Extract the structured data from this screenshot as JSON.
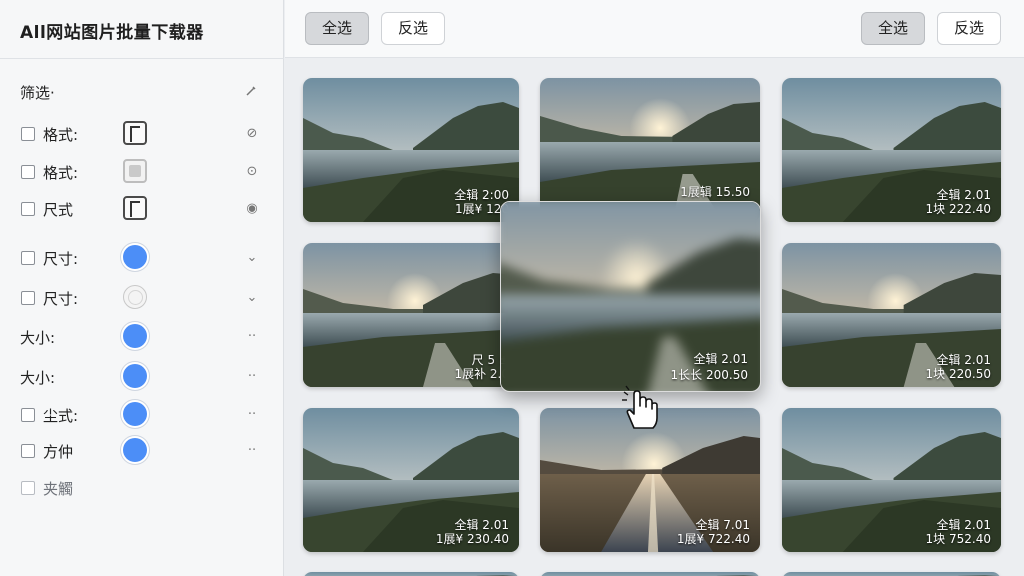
{
  "app": {
    "title": "All网站图片批量下载器"
  },
  "sidebar": {
    "filter_heading": "筛选·",
    "edit_icon": "pencil-icon",
    "rows": [
      {
        "label": "格式:",
        "checkbox": true,
        "control": "frame",
        "icon": "compass-icon",
        "icon_glyph": "⊘"
      },
      {
        "label": "格式:",
        "checkbox": true,
        "control": "gray-square",
        "icon": "play-circle-icon",
        "icon_glyph": "⊙"
      },
      {
        "label": "尺式",
        "checkbox": true,
        "control": "frame",
        "icon": "record-icon",
        "icon_glyph": "◉"
      },
      {
        "label": "尺寸:",
        "checkbox": true,
        "control": "radio-selected",
        "icon": "chevron-down-icon",
        "icon_glyph": "⌄"
      },
      {
        "label": "尺寸:",
        "checkbox": true,
        "control": "radio-empty",
        "icon": "chevron-down-icon",
        "icon_glyph": "⌄"
      },
      {
        "label": "大小:",
        "checkbox": false,
        "control": "radio-selected",
        "icon": "more-dots-icon",
        "icon_glyph": "··"
      },
      {
        "label": "大小:",
        "checkbox": false,
        "control": "radio-selected",
        "icon": "more-dots-icon",
        "icon_glyph": "··"
      },
      {
        "label": "尘式:",
        "checkbox": true,
        "control": "radio-selected",
        "icon": "more-dots-icon",
        "icon_glyph": "··"
      },
      {
        "label": "方仲",
        "checkbox": true,
        "control": "radio-selected",
        "icon": "more-dots-icon",
        "icon_glyph": "··"
      },
      {
        "label": "夹觸",
        "checkbox": true,
        "control": "none",
        "dim": true
      }
    ]
  },
  "toolbar": {
    "left": {
      "select_all": "全选",
      "invert": "反选"
    },
    "right": {
      "select_all": "全选",
      "invert": "反选"
    }
  },
  "grid": {
    "tiles": [
      {
        "line1": "全辑 2:00",
        "line2": "1展¥ 120",
        "scene": "lake"
      },
      {
        "line1": "1展辑 15.50",
        "line2": "",
        "scene": "sunrise"
      },
      {
        "line1": "全辑 2.01",
        "line2": "1块 222.40",
        "scene": "lake"
      },
      {
        "line1": "",
        "line2": "",
        "scene": "sunset"
      },
      {
        "line1": "尺 5 ±",
        "line2": "1展补 2.0",
        "scene": "sunset"
      },
      {
        "line1": "全辑 2.01",
        "line2": "1块 220.50",
        "scene": "sunset"
      },
      {
        "line1": "全辑 2.01",
        "line2": "1展¥ 230.40",
        "scene": "lake"
      },
      {
        "line1": "全辑 7.01",
        "line2": "1展¥ 722.40",
        "scene": "road"
      },
      {
        "line1": "全辑 2.01",
        "line2": "1块 752.40",
        "scene": "lake"
      }
    ],
    "dragging": {
      "line1": "全辑 2.01",
      "line2": "1长长 200.50"
    }
  },
  "colors": {
    "accent": "#4c8ef7",
    "sidebar_bg": "#f6f7f8",
    "canvas_bg": "#eceef1"
  }
}
